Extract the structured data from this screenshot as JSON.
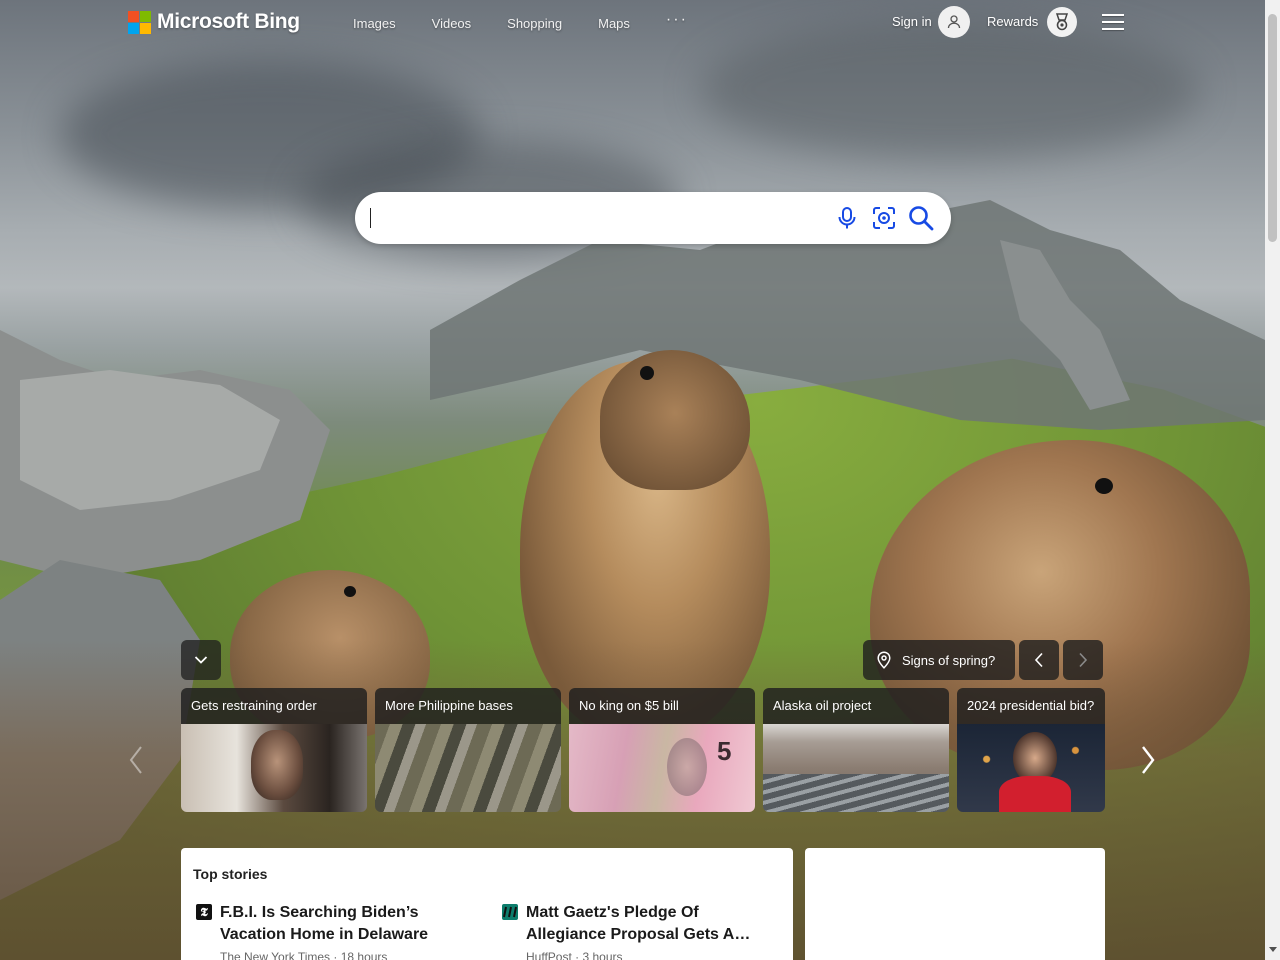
{
  "header": {
    "brand": "Microsoft Bing",
    "nav": [
      "Images",
      "Videos",
      "Shopping",
      "Maps"
    ],
    "more_label": "···",
    "signin_label": "Sign in",
    "rewards_label": "Rewards"
  },
  "search": {
    "value": "",
    "icons": [
      "microphone-icon",
      "visual-search-icon",
      "search-icon"
    ],
    "accent_color": "#174ae4"
  },
  "hero": {
    "location_label": "Signs of spring?"
  },
  "trending": [
    {
      "caption": "Gets restraining order"
    },
    {
      "caption": "More Philippine bases"
    },
    {
      "caption": "No king on $5 bill"
    },
    {
      "caption": "Alaska oil project"
    },
    {
      "caption": "2024 presidential bid?"
    }
  ],
  "top_stories": {
    "heading": "Top stories",
    "items": [
      {
        "title": "F.B.I. Is Searching Biden’s Vacation Home in Delaware",
        "source": "The New York Times · 18 hours"
      },
      {
        "title": "Matt Gaetz's Pledge Of Allegiance Proposal Gets A…",
        "source": "HuffPost · 3 hours"
      }
    ]
  }
}
